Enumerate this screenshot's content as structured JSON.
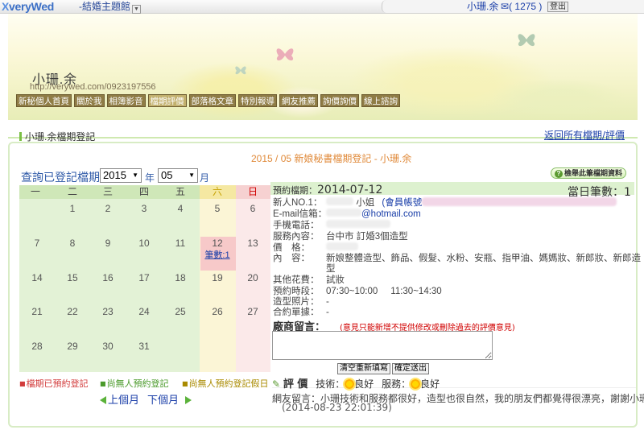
{
  "topbar": {
    "logo": "veryWed",
    "logo_x": "X",
    "theme_menu": "結婚主題館",
    "user_name": "小珊.余",
    "mail_count": "( 1275 )",
    "logout": "登出"
  },
  "banner": {
    "site_name": "小珊.余",
    "site_url": "http://verywed.com/0923197556"
  },
  "nav": [
    "新秘個人首頁",
    "關於我",
    "相簿影音",
    "檔期評價",
    "部落格文章",
    "特別報導",
    "網友推薦",
    "詢價詢價",
    "線上諮詢"
  ],
  "nav_active_index": 3,
  "section": {
    "title": "小珊.余檔期登記",
    "back_link": "返回所有檔期/評價"
  },
  "calendar": {
    "frame_title": "2015 / 05 新娘秘書檔期登記 - 小珊.余",
    "query_label": "查詢已登記檔期",
    "year": "2015",
    "year_unit": "年",
    "month": "05",
    "month_unit": "月",
    "weekdays": [
      "一",
      "二",
      "三",
      "四",
      "五",
      "六",
      "日"
    ],
    "weeks": [
      [
        "",
        "1",
        "2",
        "3",
        "4",
        "5",
        "6"
      ],
      [
        "7",
        "8",
        "9",
        "10",
        "11",
        "12",
        "13"
      ],
      [
        "14",
        "15",
        "16",
        "17",
        "18",
        "19",
        "20"
      ],
      [
        "21",
        "22",
        "23",
        "24",
        "25",
        "26",
        "27"
      ],
      [
        "28",
        "29",
        "30",
        "31",
        "",
        "",
        ""
      ]
    ],
    "booked_link": "筆數:1",
    "legend": {
      "booked": "檔期已預約登記",
      "free": "尚無人預約登記",
      "free_holiday": "尚無人預約登記假日"
    },
    "prev_month": "上個月",
    "next_month": "下個月",
    "colors": {
      "weekday_header": "#cfe7b8",
      "weekday_body": "#e3f2d6",
      "saturday_header": "#f5e8a2",
      "saturday_body": "#fbf5d6",
      "sunday_header": "#f6d1d1",
      "sunday_body": "#fbe9e9",
      "booked": "#f7c9c9"
    }
  },
  "detail": {
    "help_button": "檢舉此筆檔期資料",
    "resv_label": "預約檔期：",
    "resv_date": "2014-07-12",
    "count_label": "當日筆數：",
    "count_value": "1",
    "rows": {
      "new_person_label": "新人NO.1：",
      "title_suffix": "小姐",
      "member_label": "(會員帳號",
      "email_label": "E-mail信箱：",
      "email_suffix": "@hotmail.com",
      "phone_label": "手機電話：",
      "service_label": "服務內容：",
      "service_value": "台中市 訂婚3個造型",
      "price_label": "價　格：",
      "content_label": "內　容：",
      "content_value_1": "新娘整體造型、飾品、假髮、水粉、安瓶、指甲油、媽媽妝、新郎妝、新郎造",
      "content_value_2": "型",
      "other_label": "其他花費：",
      "other_value": "試妝",
      "time_label": "預約時段：",
      "time_value_1": "07:30~10:00",
      "time_value_2": "11:30~14:30",
      "photo_label": "造型照片：",
      "photo_value": "-",
      "contract_label": "合約單據：",
      "contract_value": "-"
    },
    "msg_title": "廠商留言：",
    "msg_warn": "(意見只能新增不提供修改或刪除過去的評價意見)",
    "btn_clear": "清空重新填寫",
    "btn_submit": "確定送出",
    "eval_title": "評 價",
    "tech_label": "技術：",
    "tech_value": "良好",
    "service_rating_label": "服務：",
    "service_rating_value": "良好",
    "comment": "網友留言：小珊技術和服務都很好，造型也很自然，我的朋友們都覺得很漂亮，謝謝小珊。",
    "comment_time": "(2014-08-23 22:01:39)"
  }
}
